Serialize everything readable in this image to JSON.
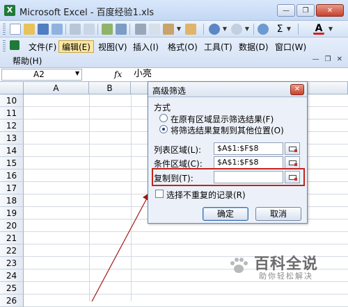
{
  "window": {
    "title": "Microsoft Excel - 百度经验1.xls",
    "minimize_label": "—",
    "restore_label": "❐",
    "close_label": "✕"
  },
  "menubar": {
    "items": [
      "文件(F)",
      "编辑(E)",
      "视图(V)",
      "插入(I)",
      "格式(O)",
      "工具(T)",
      "数据(D)",
      "窗口(W)"
    ],
    "active_index": 1,
    "help": "帮助(H)"
  },
  "formula_bar": {
    "name_box": "A2",
    "fx": "fx",
    "value": "小亮"
  },
  "grid": {
    "columns": [
      "A",
      "B",
      "C"
    ],
    "rows": [
      "10",
      "11",
      "12",
      "13",
      "14",
      "15",
      "16",
      "17",
      "18",
      "19",
      "20",
      "21",
      "22",
      "23",
      "24",
      "25",
      "26"
    ]
  },
  "dialog": {
    "title": "高级筛选",
    "section_label": "方式",
    "options": [
      {
        "label": "在原有区域显示筛选结果(F)",
        "checked": false
      },
      {
        "label": "将筛选结果复制到其他位置(O)",
        "checked": true
      }
    ],
    "list_range_label": "列表区域(L):",
    "list_range_value": "$A$1:$F$8",
    "criteria_range_label": "条件区域(C):",
    "criteria_range_value": "$A$1:$F$8",
    "copy_to_label": "复制到(T):",
    "copy_to_value": "",
    "unique_label": "选择不重复的记录(R)",
    "unique_checked": false,
    "ok_label": "确定",
    "cancel_label": "取消"
  },
  "watermark": {
    "main": "百科全说",
    "sub": "助你轻松解决"
  },
  "colors": {
    "highlight": "#c0241c",
    "active_menu": "#fbe7a4"
  }
}
